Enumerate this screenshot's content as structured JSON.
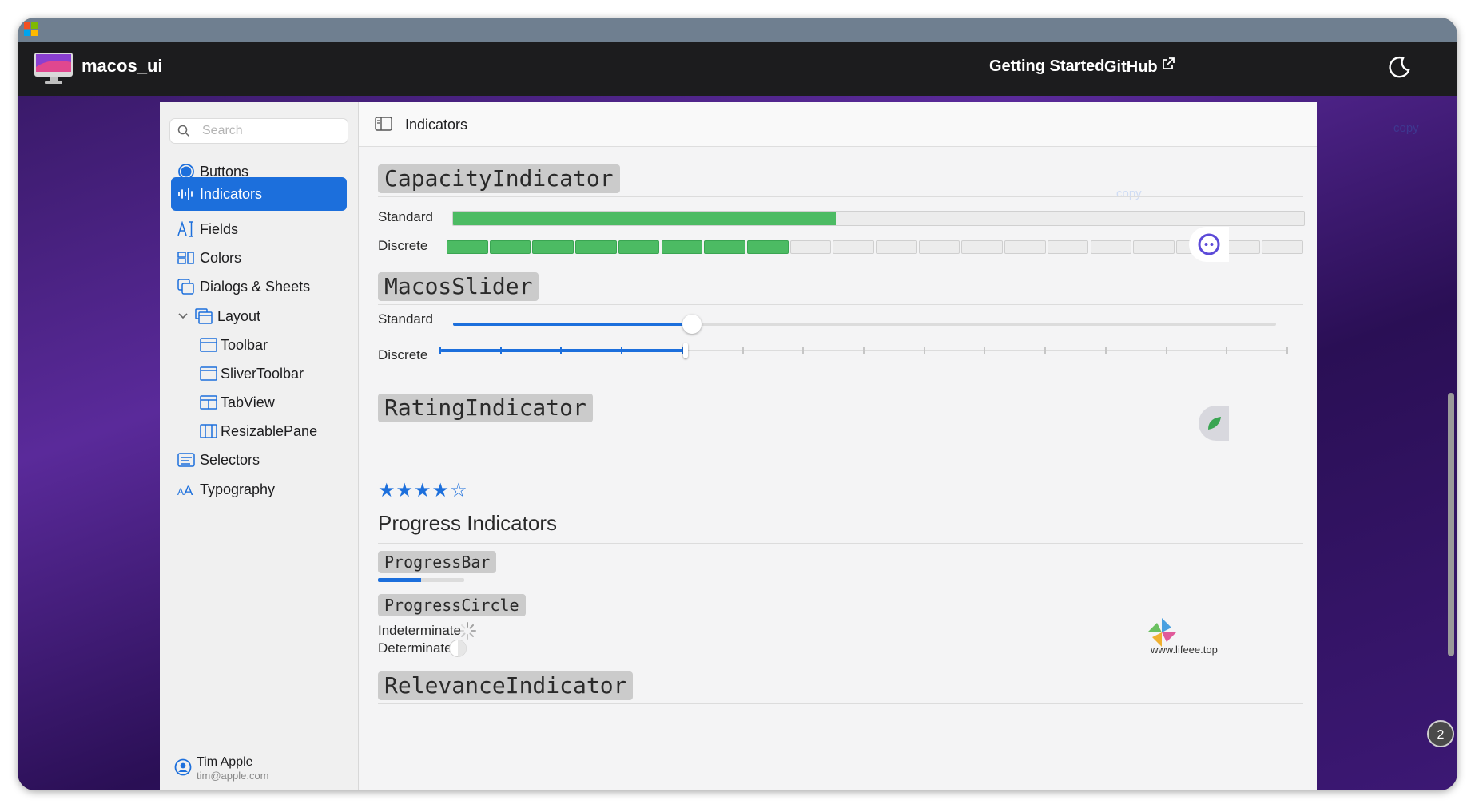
{
  "window": {
    "brand_colors": [
      "#f25022",
      "#7fba00",
      "#00a4ef",
      "#ffb900"
    ]
  },
  "navbar": {
    "title": "macos_ui",
    "links": [
      {
        "label": "Getting Started"
      },
      {
        "label": "GitHub"
      }
    ],
    "theme_toggle_icon": "moon-icon"
  },
  "sidebar": {
    "search_placeholder": "Search",
    "items": [
      {
        "label": "Buttons",
        "icon": "radio-button-icon"
      },
      {
        "label": "Indicators",
        "icon": "waveform-icon",
        "active": true
      },
      {
        "label": "Fields",
        "icon": "text-cursor-icon"
      },
      {
        "label": "Colors",
        "icon": "color-swatch-icon"
      },
      {
        "label": "Dialogs & Sheets",
        "icon": "stacked-windows-icon"
      },
      {
        "label": "Layout",
        "icon": "layout-icon",
        "expanded": true
      },
      {
        "label": "Toolbar",
        "icon": "window-icon"
      },
      {
        "label": "SliverToolbar",
        "icon": "window-icon"
      },
      {
        "label": "TabView",
        "icon": "tabs-icon"
      },
      {
        "label": "ResizablePane",
        "icon": "columns-icon"
      },
      {
        "label": "Selectors",
        "icon": "selector-icon"
      },
      {
        "label": "Typography",
        "icon": "typography-icon"
      }
    ],
    "user": {
      "name": "Tim Apple",
      "email": "tim@apple.com"
    }
  },
  "toolbar": {
    "title": "Indicators"
  },
  "content": {
    "capacity": {
      "heading": "CapacityIndicator",
      "standard_label": "Standard",
      "standard_value": 0.45,
      "discrete_label": "Discrete",
      "discrete_segments": 20,
      "discrete_filled": 8
    },
    "slider": {
      "heading": "MacosSlider",
      "standard_label": "Standard",
      "standard_value": 0.29,
      "discrete_label": "Discrete",
      "discrete_value": 0.29,
      "discrete_ticks": 15
    },
    "rating": {
      "heading": "RatingIndicator",
      "value": 4,
      "max": 5
    },
    "progress": {
      "title": "Progress Indicators",
      "bar_heading": "ProgressBar",
      "bar_value": 0.5,
      "circle_heading": "ProgressCircle",
      "indeterminate_label": "Indeterminate",
      "determinate_label": "Determinate"
    },
    "relevance": {
      "heading": "RelevanceIndicator"
    }
  },
  "overlays": {
    "copy_label": "copy",
    "notification_count": "2",
    "watermark_text": "www.lifeee.top"
  },
  "colors": {
    "accent": "#1c6fdc",
    "capacity_green": "#4cbb63"
  }
}
